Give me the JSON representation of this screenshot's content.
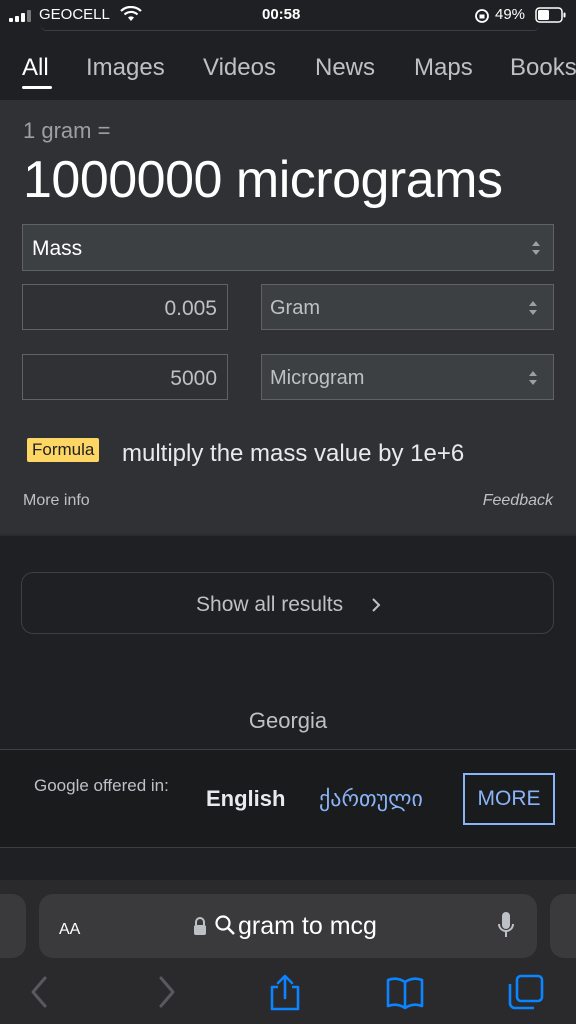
{
  "status_bar": {
    "carrier": "GEOCELL",
    "time": "00:58",
    "battery": "49%"
  },
  "tabs": [
    {
      "label": "All",
      "active": true
    },
    {
      "label": "Images"
    },
    {
      "label": "Videos"
    },
    {
      "label": "News"
    },
    {
      "label": "Maps"
    },
    {
      "label": "Books"
    }
  ],
  "converter": {
    "equation": "1 gram =",
    "result": "1000000 micrograms",
    "quantity": "Mass",
    "from_value": "0.005",
    "from_unit": "Gram",
    "to_value": "5000",
    "to_unit": "Microgram",
    "formula_badge": "Formula",
    "formula_text": "multiply the mass value by 1e+6",
    "more_info": "More info",
    "feedback": "Feedback"
  },
  "show_all": "Show all results",
  "location": "Georgia",
  "language_offer": {
    "text": "Google offered in:",
    "lang1": "English",
    "lang2": "ქართული",
    "more": "MORE"
  },
  "browser": {
    "aa": "AA",
    "url": "gram to mcg"
  },
  "colors": {
    "accent": "#8ab4f8",
    "formula_badge": "#fdd663",
    "card_bg": "#303134"
  }
}
